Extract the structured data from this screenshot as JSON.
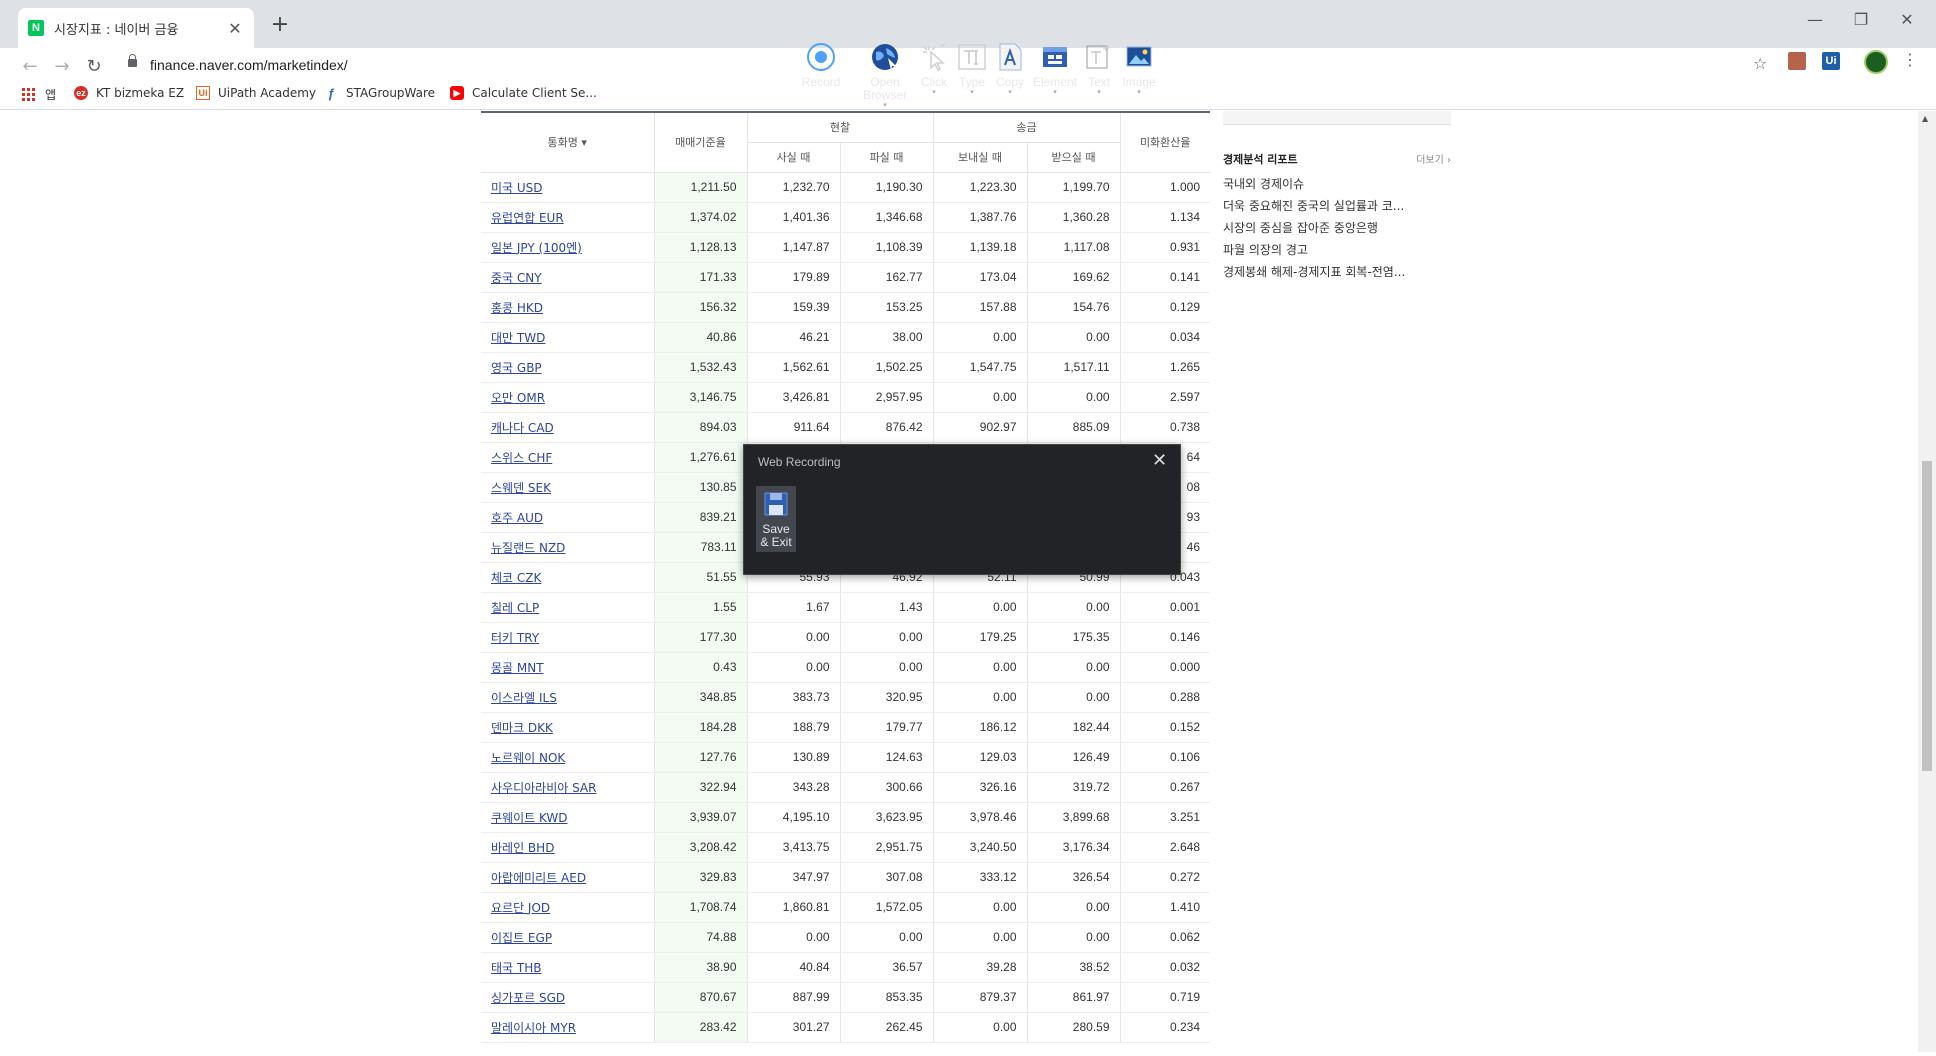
{
  "browser": {
    "tab_title": "시장지표 : 네이버 금융",
    "tab_favicon": "N",
    "new_tab": "+",
    "tab_close": "✕",
    "url": "finance.naver.com/marketindex/",
    "window_controls": [
      "—",
      "❐",
      "✕"
    ],
    "bookmarks": [
      {
        "label": "앱",
        "icon": "apps-grid-icon"
      },
      {
        "label": "KT bizmeka EZ",
        "icon": "kt-icon",
        "color": "#d93025"
      },
      {
        "label": "UiPath Academy",
        "icon": "uipath-icon",
        "color": "#e8641b"
      },
      {
        "label": "STAGroupWare",
        "icon": "sta-icon",
        "color": "#2d6bb5"
      },
      {
        "label": "Calculate Client Se...",
        "icon": "youtube-icon",
        "color": "#ff0000"
      }
    ],
    "extensions": [
      {
        "label": "",
        "icon": "pdf-icon",
        "color": "#b5634a"
      },
      {
        "label": "Ui",
        "icon": "uipath-ext-icon",
        "color": "#1f5fa8"
      }
    ]
  },
  "table": {
    "headers": {
      "currency": "통화명",
      "base_rate": "매매기준율",
      "cash": "현찰",
      "cash_buy": "사실 때",
      "cash_sell": "파실 때",
      "transfer": "송금",
      "send": "보내실 때",
      "receive": "받으실 때",
      "usd_rate": "미화환산율"
    },
    "rows": [
      {
        "name": "미국 USD",
        "cells": [
          "1,211.50",
          "1,232.70",
          "1,190.30",
          "1,223.30",
          "1,199.70",
          "1.000"
        ]
      },
      {
        "name": "유럽연합 EUR",
        "cells": [
          "1,374.02",
          "1,401.36",
          "1,346.68",
          "1,387.76",
          "1,360.28",
          "1.134"
        ]
      },
      {
        "name": "일본 JPY (100엔)",
        "cells": [
          "1,128.13",
          "1,147.87",
          "1,108.39",
          "1,139.18",
          "1,117.08",
          "0.931"
        ]
      },
      {
        "name": "중국 CNY",
        "cells": [
          "171.33",
          "179.89",
          "162.77",
          "173.04",
          "169.62",
          "0.141"
        ]
      },
      {
        "name": "홍콩 HKD",
        "cells": [
          "156.32",
          "159.39",
          "153.25",
          "157.88",
          "154.76",
          "0.129"
        ]
      },
      {
        "name": "대만 TWD",
        "cells": [
          "40.86",
          "46.21",
          "38.00",
          "0.00",
          "0.00",
          "0.034"
        ]
      },
      {
        "name": "영국 GBP",
        "cells": [
          "1,532.43",
          "1,562.61",
          "1,502.25",
          "1,547.75",
          "1,517.11",
          "1.265"
        ]
      },
      {
        "name": "오만 OMR",
        "cells": [
          "3,146.75",
          "3,426.81",
          "2,957.95",
          "0.00",
          "0.00",
          "2.597"
        ]
      },
      {
        "name": "캐나다 CAD",
        "cells": [
          "894.03",
          "911.64",
          "876.42",
          "902.97",
          "885.09",
          "0.738"
        ]
      },
      {
        "name": "스위스 CHF",
        "cells": [
          "1,276.61",
          "",
          "",
          "",
          "",
          "64"
        ]
      },
      {
        "name": "스웨덴 SEK",
        "cells": [
          "130.85",
          "",
          "",
          "",
          "",
          "08"
        ]
      },
      {
        "name": "호주 AUD",
        "cells": [
          "839.21",
          "",
          "",
          "",
          "",
          "93"
        ]
      },
      {
        "name": "뉴질랜드 NZD",
        "cells": [
          "783.11",
          "",
          "",
          "",
          "",
          "46"
        ]
      },
      {
        "name": "체코 CZK",
        "cells": [
          "51.55",
          "55.93",
          "46.92",
          "52.11",
          "50.99",
          "0.043"
        ]
      },
      {
        "name": "칠레 CLP",
        "cells": [
          "1.55",
          "1.67",
          "1.43",
          "0.00",
          "0.00",
          "0.001"
        ]
      },
      {
        "name": "터키 TRY",
        "cells": [
          "177.30",
          "0.00",
          "0.00",
          "179.25",
          "175.35",
          "0.146"
        ]
      },
      {
        "name": "몽골 MNT",
        "cells": [
          "0.43",
          "0.00",
          "0.00",
          "0.00",
          "0.00",
          "0.000"
        ]
      },
      {
        "name": "이스라엘 ILS",
        "cells": [
          "348.85",
          "383.73",
          "320.95",
          "0.00",
          "0.00",
          "0.288"
        ]
      },
      {
        "name": "덴마크 DKK",
        "cells": [
          "184.28",
          "188.79",
          "179.77",
          "186.12",
          "182.44",
          "0.152"
        ]
      },
      {
        "name": "노르웨이 NOK",
        "cells": [
          "127.76",
          "130.89",
          "124.63",
          "129.03",
          "126.49",
          "0.106"
        ]
      },
      {
        "name": "사우디아라비아 SAR",
        "cells": [
          "322.94",
          "343.28",
          "300.66",
          "326.16",
          "319.72",
          "0.267"
        ]
      },
      {
        "name": "쿠웨이트 KWD",
        "cells": [
          "3,939.07",
          "4,195.10",
          "3,623.95",
          "3,978.46",
          "3,899.68",
          "3.251"
        ]
      },
      {
        "name": "바레인 BHD",
        "cells": [
          "3,208.42",
          "3,413.75",
          "2,951.75",
          "3,240.50",
          "3,176.34",
          "2.648"
        ]
      },
      {
        "name": "아랍에미리트 AED",
        "cells": [
          "329.83",
          "347.97",
          "307.08",
          "333.12",
          "326.54",
          "0.272"
        ]
      },
      {
        "name": "요르단 JOD",
        "cells": [
          "1,708.74",
          "1,860.81",
          "1,572.05",
          "0.00",
          "0.00",
          "1.410"
        ]
      },
      {
        "name": "이집트 EGP",
        "cells": [
          "74.88",
          "0.00",
          "0.00",
          "0.00",
          "0.00",
          "0.062"
        ]
      },
      {
        "name": "태국 THB",
        "cells": [
          "38.90",
          "40.84",
          "36.57",
          "39.28",
          "38.52",
          "0.032"
        ]
      },
      {
        "name": "싱가포르 SGD",
        "cells": [
          "870.67",
          "887.99",
          "853.35",
          "879.37",
          "861.97",
          "0.719"
        ]
      },
      {
        "name": "말레이시아 MYR",
        "cells": [
          "283.42",
          "301.27",
          "262.45",
          "0.00",
          "280.59",
          "0.234"
        ]
      }
    ]
  },
  "sidebar": {
    "title": "경제분석 리포트",
    "more": "더보기",
    "items": [
      "국내외 경제이슈",
      "더욱 중요해진 중국의 실업률과 코...",
      "시장의 중심을 잡아준 중앙은행",
      "파월 의장의 경고",
      "경제봉쇄 해제-경제지표 회복-전염..."
    ]
  },
  "recorder": {
    "title": "Web Recording",
    "tools": [
      {
        "label": "Save & Exit",
        "icon": "save-icon"
      },
      {
        "label": "Record",
        "icon": "record-icon"
      },
      {
        "label": "Open Browser",
        "icon": "globe-icon"
      },
      {
        "label": "Click",
        "icon": "click-icon"
      },
      {
        "label": "Type",
        "icon": "type-icon"
      },
      {
        "label": "Copy",
        "icon": "copy-icon"
      },
      {
        "label": "Element",
        "icon": "element-icon"
      },
      {
        "label": "Text",
        "icon": "text-icon"
      },
      {
        "label": "Image",
        "icon": "image-icon"
      }
    ]
  }
}
